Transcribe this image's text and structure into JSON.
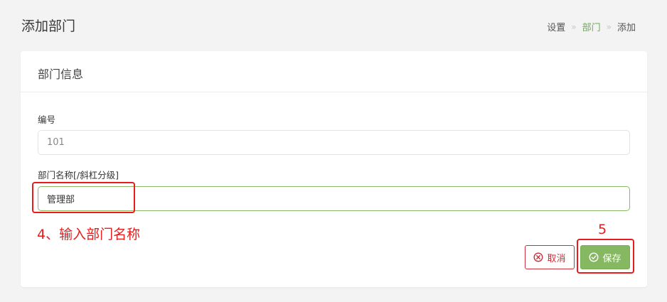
{
  "header": {
    "title": "添加部门",
    "breadcrumb": [
      {
        "label": "设置"
      },
      {
        "label": "部门",
        "active": true
      },
      {
        "label": "添加"
      }
    ],
    "separator": "»"
  },
  "card": {
    "title": "部门信息",
    "fields": {
      "number": {
        "label": "编号",
        "value": "101"
      },
      "name": {
        "label": "部门名称[/斜杠分级]",
        "value": "管理部"
      }
    },
    "buttons": {
      "cancel": {
        "label": "取消",
        "icon": "x-circle-icon"
      },
      "save": {
        "label": "保存",
        "icon": "check-circle-icon"
      }
    }
  },
  "annotations": {
    "step4": "4、输入部门名称",
    "step5": "5"
  },
  "colors": {
    "accent": "#86b862",
    "danger": "#c9303a",
    "annotation": "#e81c1c"
  }
}
